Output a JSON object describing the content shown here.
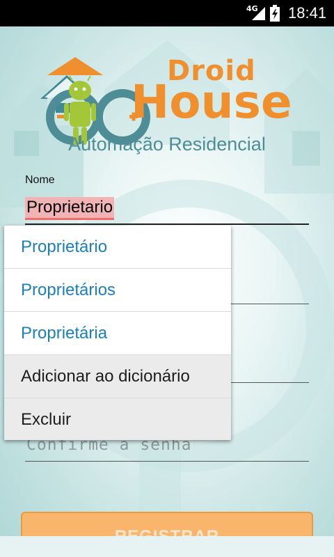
{
  "status_bar": {
    "network": "4G",
    "time": "18:41",
    "icons": [
      "signal-icon",
      "battery-charging-icon"
    ]
  },
  "logo": {
    "word1": "Droid",
    "word2": "House",
    "mascot": "android-robot-icon",
    "brand_color": "#ef8f2e",
    "accent_color": "#4e8d95"
  },
  "subtitle": "Automação Residencial",
  "form": {
    "name_label": "Nome",
    "name_value": "Proprietario",
    "confirm_password_placeholder": "Confirme a senha"
  },
  "suggestions_popup": {
    "suggestions": [
      "Proprietário",
      "Proprietários",
      "Proprietária"
    ],
    "actions": [
      "Adicionar ao dicionário",
      "Excluir"
    ]
  },
  "register_button": {
    "label": "REGISTRAR"
  }
}
